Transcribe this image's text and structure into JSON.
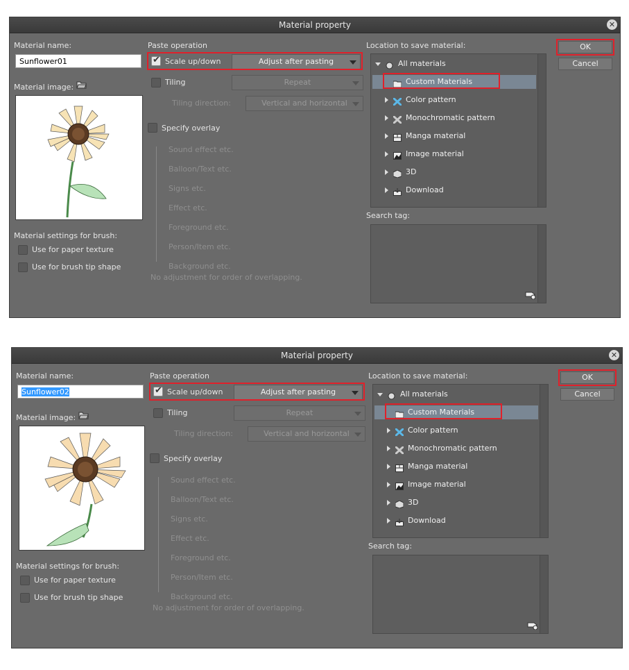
{
  "dialogs": [
    {
      "title": "Material property",
      "material_name_label": "Material name:",
      "material_name_value": "Sunflower01",
      "material_name_selected": false,
      "material_image_label": "Material image:",
      "paste_operation_label": "Paste operation",
      "scale_label": "Scale up/down",
      "scale_checked": true,
      "adjust_option": "Adjust after pasting",
      "tiling_label": "Tiling",
      "tiling_checked": false,
      "repeat_option": "Repeat",
      "tiling_direction_label": "Tiling direction:",
      "tiling_direction_option": "Vertical and horizontal",
      "specify_overlay_label": "Specify overlay",
      "overlay_items": [
        "Sound effect etc.",
        "Balloon/Text etc.",
        "Signs etc.",
        "Effect etc.",
        "Foreground etc.",
        "Person/Item etc.",
        "Background etc."
      ],
      "overlay_note": "No adjustment for order of overlapping.",
      "brush_settings_label": "Material settings for brush:",
      "paper_texture_label": "Use for paper texture",
      "brush_tip_label": "Use for brush tip shape",
      "location_label": "Location to save material:",
      "tree": {
        "root": "All materials",
        "selected": "Custom Materials",
        "children": [
          "Color pattern",
          "Monochromatic pattern",
          "Manga material",
          "Image material",
          "3D",
          "Download"
        ]
      },
      "search_tag_label": "Search tag:",
      "ok_label": "OK",
      "cancel_label": "Cancel"
    },
    {
      "title": "Material property",
      "material_name_label": "Material name:",
      "material_name_value": "Sunflower02",
      "material_name_selected": true,
      "material_image_label": "Material image:",
      "paste_operation_label": "Paste operation",
      "scale_label": "Scale up/down",
      "scale_checked": true,
      "adjust_option": "Adjust after pasting",
      "tiling_label": "Tiling",
      "tiling_checked": false,
      "repeat_option": "Repeat",
      "tiling_direction_label": "Tiling direction:",
      "tiling_direction_option": "Vertical and horizontal",
      "specify_overlay_label": "Specify overlay",
      "overlay_items": [
        "Sound effect etc.",
        "Balloon/Text etc.",
        "Signs etc.",
        "Effect etc.",
        "Foreground etc.",
        "Person/Item etc.",
        "Background etc."
      ],
      "overlay_note": "No adjustment for order of overlapping.",
      "brush_settings_label": "Material settings for brush:",
      "paper_texture_label": "Use for paper texture",
      "brush_tip_label": "Use for brush tip shape",
      "location_label": "Location to save material:",
      "tree": {
        "root": "All materials",
        "selected": "Custom Materials",
        "children": [
          "Color pattern",
          "Monochromatic pattern",
          "Manga material",
          "Image material",
          "3D",
          "Download"
        ]
      },
      "search_tag_label": "Search tag:",
      "ok_label": "OK",
      "cancel_label": "Cancel"
    }
  ],
  "colors": {
    "dialog_bg": "#6a6a6a",
    "highlight_red": "#e0202a",
    "tree_selection": "#7a8794",
    "text_selection": "#3399ff"
  }
}
